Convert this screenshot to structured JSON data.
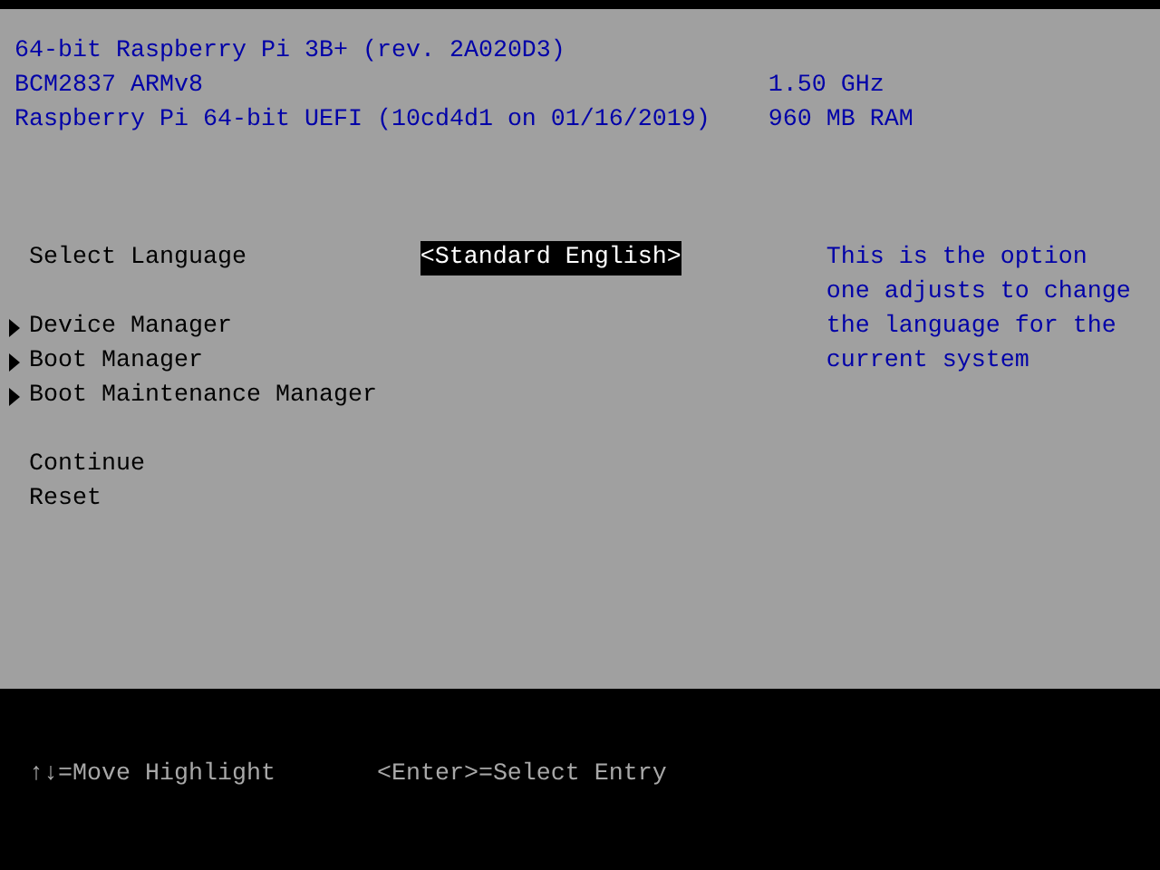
{
  "header": {
    "lines": [
      {
        "left": "64-bit Raspberry Pi 3B+ (rev. 2A020D3)"
      },
      {
        "left": "BCM2837 ARMv8",
        "right": "1.50 GHz"
      },
      {
        "left": "Raspberry Pi 64-bit UEFI (10cd4d1 on 01/16/2019)",
        "right": "960 MB RAM"
      }
    ]
  },
  "menu": {
    "groups": [
      [
        {
          "kind": "option",
          "label": "Select Language",
          "value": "<Standard English>",
          "selected": true
        }
      ],
      [
        {
          "kind": "submenu",
          "label": "Device Manager",
          "selected": false
        },
        {
          "kind": "submenu",
          "label": "Boot Manager",
          "selected": false
        },
        {
          "kind": "submenu",
          "label": "Boot Maintenance Manager",
          "selected": false
        }
      ],
      [
        {
          "kind": "action",
          "label": "Continue",
          "selected": false
        },
        {
          "kind": "action",
          "label": "Reset",
          "selected": false
        }
      ]
    ],
    "help": "This is the option one adjusts to change the language for the current system"
  },
  "footer": {
    "hints": [
      "↑↓=Move Highlight",
      "<Enter>=Select Entry"
    ]
  }
}
